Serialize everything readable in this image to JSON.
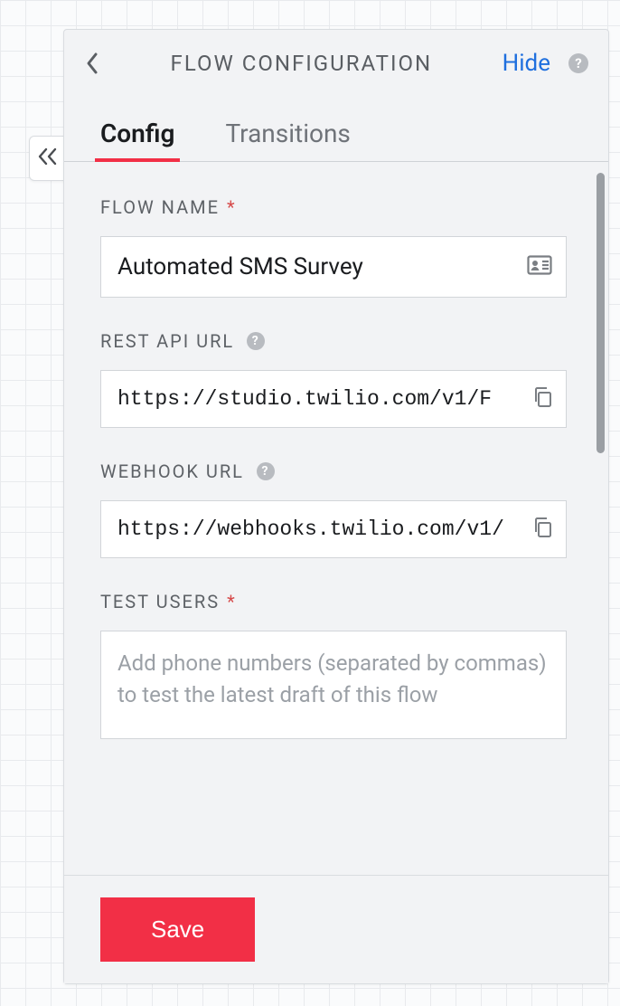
{
  "header": {
    "title": "FLOW CONFIGURATION",
    "hide_label": "Hide"
  },
  "tabs": {
    "config": "Config",
    "transitions": "Transitions"
  },
  "form": {
    "flow_name": {
      "label": "FLOW NAME",
      "value": "Automated SMS Survey"
    },
    "rest_api_url": {
      "label": "REST API URL",
      "value": "https://studio.twilio.com/v1/F"
    },
    "webhook_url": {
      "label": "WEBHOOK URL",
      "value": "https://webhooks.twilio.com/v1/"
    },
    "test_users": {
      "label": "TEST USERS",
      "placeholder": "Add phone numbers (separated by commas) to test the latest draft of this flow"
    }
  },
  "footer": {
    "save_label": "Save"
  },
  "icons": {
    "help_glyph": "?",
    "required": "*"
  }
}
